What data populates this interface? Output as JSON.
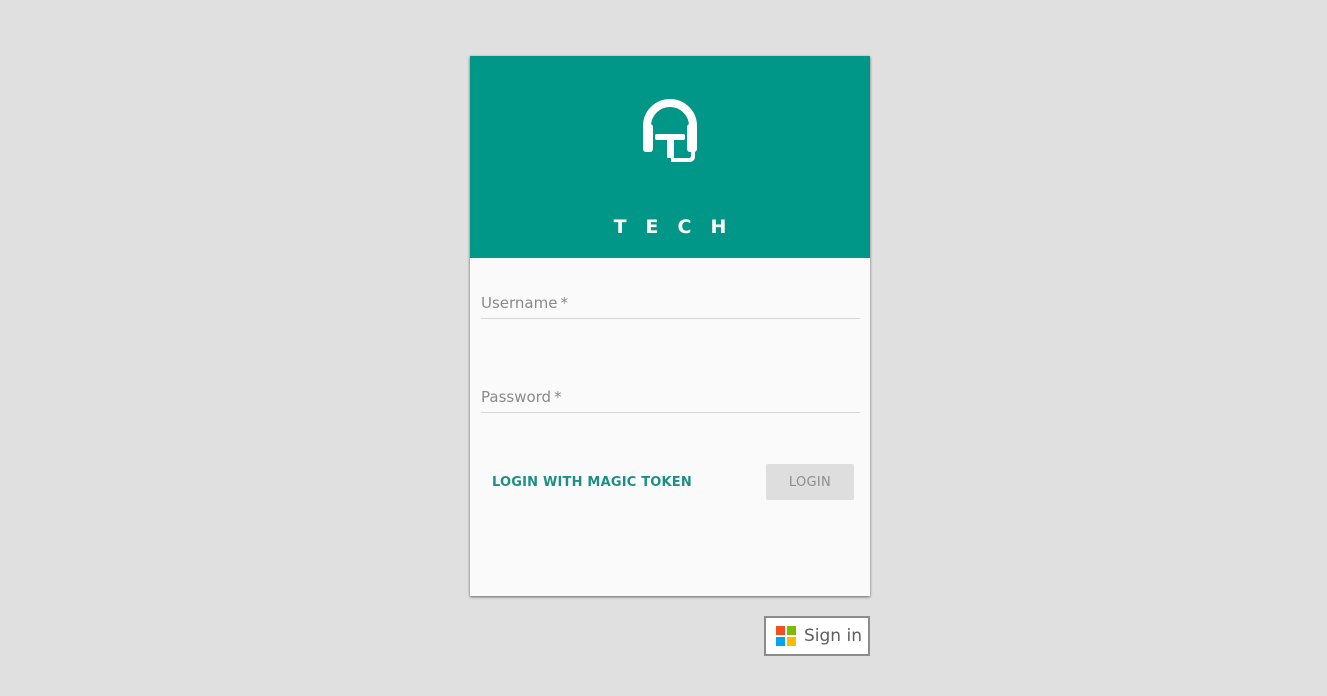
{
  "brand": {
    "name": "TECH",
    "header_color": "#009688",
    "logo_icon": "headset-icon"
  },
  "form": {
    "username": {
      "label": "Username",
      "required_mark": "*",
      "value": ""
    },
    "password": {
      "label": "Password",
      "required_mark": "*",
      "value": ""
    },
    "magic_token_label": "LOGIN WITH MAGIC TOKEN",
    "login_label": "LOGIN"
  },
  "microsoft_signin": {
    "label": "Sign in",
    "logo_icon": "microsoft-logo-icon",
    "logo_colors": [
      "#f25022",
      "#7fba00",
      "#00a4ef",
      "#ffb900"
    ]
  },
  "colors": {
    "background": "#e0e0e0",
    "accent": "#009688",
    "accent_text": "#1e8f84"
  }
}
